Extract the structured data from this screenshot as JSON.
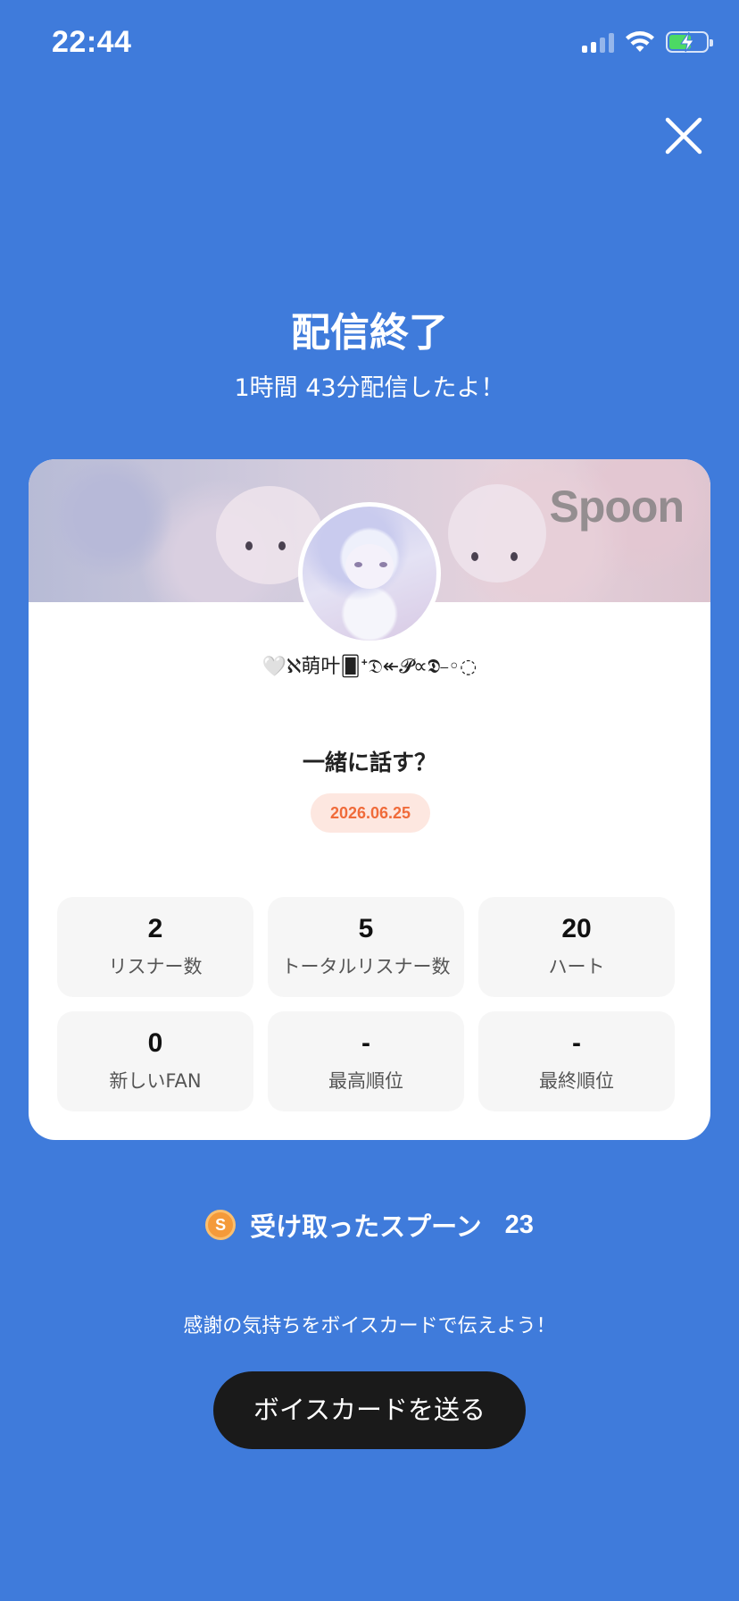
{
  "status_bar": {
    "time": "22:44",
    "icons": [
      "signal-icon",
      "wifi-icon",
      "battery-charging-icon"
    ]
  },
  "header": {
    "title": "配信終了",
    "subtitle": "1時間 43分配信したよ！"
  },
  "card": {
    "brand_logo": "Spoon",
    "username": "🤍ℵ萌叶🂠ᐩ𝔇↞𝓟∝𝕯⎯◦◌",
    "stream_title": "一緒に話す？",
    "date": "2026.06.25",
    "stats": [
      {
        "value": "2",
        "label": "リスナー数"
      },
      {
        "value": "5",
        "label": "トータルリスナー数"
      },
      {
        "value": "20",
        "label": "ハート"
      },
      {
        "value": "0",
        "label": "新しいFAN"
      },
      {
        "value": "-",
        "label": "最高順位"
      },
      {
        "value": "-",
        "label": "最終順位"
      }
    ]
  },
  "spoons": {
    "icon_letter": "S",
    "label": "受け取ったスプーン",
    "count": "23"
  },
  "thanks_message": "感謝の気持ちをボイスカードで伝えよう！",
  "voice_card_button": "ボイスカードを送る",
  "colors": {
    "background": "#3f7bdb",
    "date_badge_text": "#f06b3a",
    "date_badge_bg": "#fde7e0",
    "button_bg": "#1a1a1a",
    "coin": "#f49a3a"
  }
}
